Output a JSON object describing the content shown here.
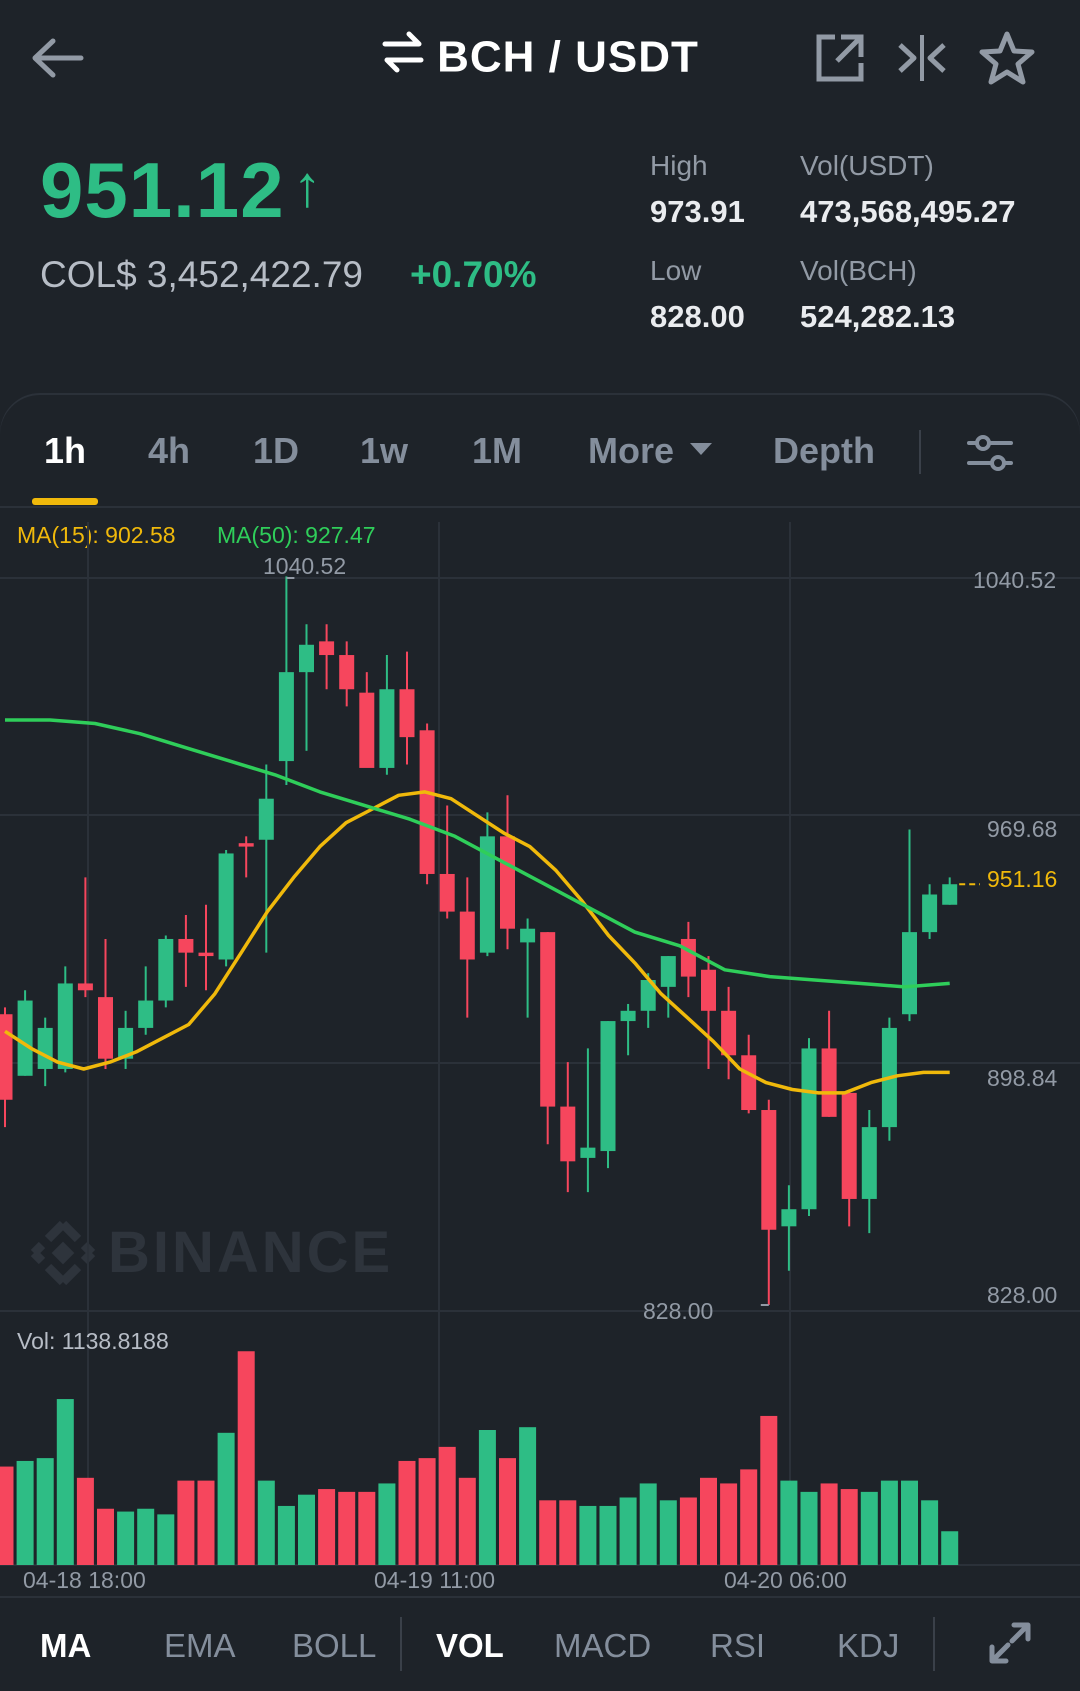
{
  "header": {
    "pair": "BCH / USDT",
    "icons": [
      "back-arrow-icon",
      "swap-icon",
      "share-icon",
      "compare-icon",
      "star-icon"
    ]
  },
  "ticker": {
    "last_price": "951.12",
    "direction": "↑",
    "fiat": "COL$ 3,452,422.79",
    "change_pct": "+0.70%",
    "high_label": "High",
    "high": "973.91",
    "low_label": "Low",
    "low": "828.00",
    "vol_quote_label": "Vol(USDT)",
    "vol_quote": "473,568,495.27",
    "vol_base_label": "Vol(BCH)",
    "vol_base": "524,282.13"
  },
  "tabs": {
    "items": [
      "1h",
      "4h",
      "1D",
      "1w",
      "1M",
      "More",
      "Depth"
    ],
    "active": "1h"
  },
  "indicators_legend": {
    "ma15": "MA(15): 902.58",
    "ma50": "MA(50): 927.47",
    "vol": "Vol: 1138.8188"
  },
  "chart_labels": {
    "y_ticks": [
      "1040.52",
      "969.68",
      "898.84",
      "828.00"
    ],
    "x_ticks": [
      "04-18 18:00",
      "04-19 11:00",
      "04-20 06:00"
    ],
    "max_marker": "1040.52",
    "min_marker": "828.00",
    "current_price_marker": "951.16",
    "watermark": "BINANCE"
  },
  "bottom_bar": {
    "items": [
      "MA",
      "EMA",
      "BOLL",
      "VOL",
      "MACD",
      "RSI",
      "KDJ"
    ],
    "active": [
      "MA",
      "VOL"
    ]
  },
  "colors": {
    "up": "#2ebd85",
    "down": "#f6465d",
    "ma15": "#f0b90b",
    "ma50": "#2fce5a",
    "background": "#1e2329",
    "accent": "#f0b90b"
  },
  "chart_data": {
    "type": "candlestick",
    "ylim": [
      828.0,
      1040.52
    ],
    "grid": true,
    "candles": [
      {
        "o": 913,
        "h": 915,
        "l": 880,
        "c": 888
      },
      {
        "o": 895,
        "h": 920,
        "l": 895,
        "c": 917
      },
      {
        "o": 897,
        "h": 912,
        "l": 892,
        "c": 909
      },
      {
        "o": 897,
        "h": 927,
        "l": 896,
        "c": 922
      },
      {
        "o": 922,
        "h": 953,
        "l": 918,
        "c": 920
      },
      {
        "o": 918,
        "h": 935,
        "l": 897,
        "c": 900
      },
      {
        "o": 900,
        "h": 914,
        "l": 897,
        "c": 909
      },
      {
        "o": 909,
        "h": 927,
        "l": 907,
        "c": 917
      },
      {
        "o": 917,
        "h": 936,
        "l": 915,
        "c": 935
      },
      {
        "o": 935,
        "h": 942,
        "l": 921,
        "c": 931
      },
      {
        "o": 931,
        "h": 945,
        "l": 920,
        "c": 930
      },
      {
        "o": 929,
        "h": 961,
        "l": 927,
        "c": 960
      },
      {
        "o": 963,
        "h": 965,
        "l": 953,
        "c": 962
      },
      {
        "o": 964,
        "h": 986,
        "l": 931,
        "c": 976
      },
      {
        "o": 987,
        "h": 1041,
        "l": 980,
        "c": 1013
      },
      {
        "o": 1013,
        "h": 1027,
        "l": 990,
        "c": 1021
      },
      {
        "o": 1022,
        "h": 1027,
        "l": 1008,
        "c": 1018
      },
      {
        "o": 1018,
        "h": 1022,
        "l": 1003,
        "c": 1008
      },
      {
        "o": 1007,
        "h": 1013,
        "l": 986,
        "c": 985
      },
      {
        "o": 985,
        "h": 1018,
        "l": 983,
        "c": 1008
      },
      {
        "o": 1008,
        "h": 1019,
        "l": 986,
        "c": 994
      },
      {
        "o": 996,
        "h": 998,
        "l": 951,
        "c": 954
      },
      {
        "o": 954,
        "h": 974,
        "l": 941,
        "c": 943
      },
      {
        "o": 943,
        "h": 953,
        "l": 912,
        "c": 929
      },
      {
        "o": 931,
        "h": 972,
        "l": 930,
        "c": 965
      },
      {
        "o": 965,
        "h": 977,
        "l": 932,
        "c": 938
      },
      {
        "o": 934,
        "h": 941,
        "l": 912,
        "c": 938
      },
      {
        "o": 937,
        "h": 937,
        "l": 875,
        "c": 886
      },
      {
        "o": 886,
        "h": 899,
        "l": 861,
        "c": 870
      },
      {
        "o": 871,
        "h": 903,
        "l": 861,
        "c": 874
      },
      {
        "o": 873,
        "h": 911,
        "l": 868,
        "c": 911
      },
      {
        "o": 911,
        "h": 916,
        "l": 901,
        "c": 914
      },
      {
        "o": 914,
        "h": 925,
        "l": 909,
        "c": 923
      },
      {
        "o": 921,
        "h": 930,
        "l": 912,
        "c": 930
      },
      {
        "o": 935,
        "h": 940,
        "l": 918,
        "c": 924
      },
      {
        "o": 926,
        "h": 930,
        "l": 897,
        "c": 914
      },
      {
        "o": 914,
        "h": 921,
        "l": 894,
        "c": 901
      },
      {
        "o": 901,
        "h": 907,
        "l": 884,
        "c": 885
      },
      {
        "o": 885,
        "h": 888,
        "l": 828,
        "c": 850
      },
      {
        "o": 851,
        "h": 863,
        "l": 838,
        "c": 856
      },
      {
        "o": 856,
        "h": 906,
        "l": 854,
        "c": 903
      },
      {
        "o": 903,
        "h": 914,
        "l": 883,
        "c": 883
      },
      {
        "o": 890,
        "h": 891,
        "l": 851,
        "c": 859
      },
      {
        "o": 859,
        "h": 885,
        "l": 849,
        "c": 880
      },
      {
        "o": 880,
        "h": 912,
        "l": 876,
        "c": 909
      },
      {
        "o": 913,
        "h": 967,
        "l": 911,
        "c": 937
      },
      {
        "o": 937,
        "h": 951,
        "l": 935,
        "c": 948
      },
      {
        "o": 945,
        "h": 953,
        "l": 945,
        "c": 951
      }
    ],
    "ma15": [
      908,
      903,
      899,
      897,
      899,
      902,
      906,
      910,
      919,
      931,
      943,
      953,
      962,
      969,
      973,
      977,
      978,
      976,
      971,
      966,
      962,
      955,
      946,
      936,
      928,
      919,
      912,
      905,
      897,
      893,
      891,
      890,
      890,
      893,
      895,
      896,
      896
    ],
    "ma50": [
      999,
      999,
      998,
      995,
      991,
      987,
      983,
      978,
      974,
      970,
      965,
      958,
      951,
      944,
      937,
      933,
      926,
      924,
      923,
      922,
      921,
      922
    ],
    "volume": [
      1750,
      1850,
      1900,
      2950,
      1550,
      1000,
      950,
      1000,
      900,
      1500,
      1500,
      2350,
      3800,
      1500,
      1050,
      1250,
      1350,
      1300,
      1300,
      1450,
      1850,
      1900,
      2100,
      1550,
      2400,
      1900,
      2450,
      1150,
      1150,
      1050,
      1050,
      1200,
      1450,
      1150,
      1200,
      1550,
      1450,
      1700,
      2650,
      1500,
      1300,
      1450,
      1350,
      1300,
      1500,
      1500,
      1150,
      600
    ]
  }
}
